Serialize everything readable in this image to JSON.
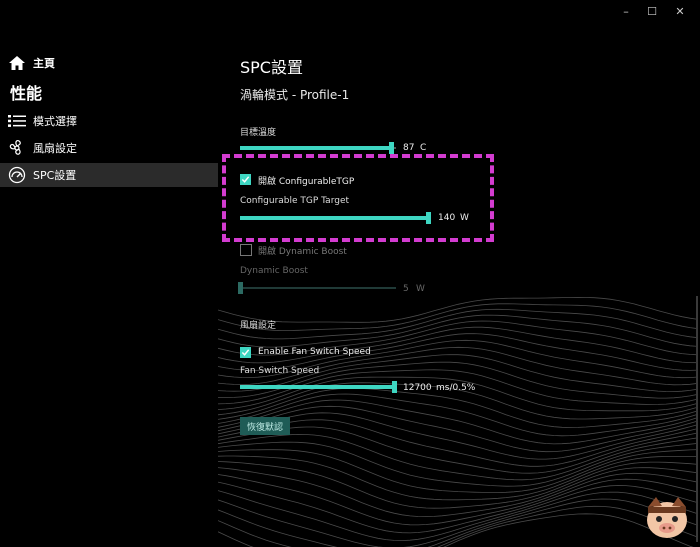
{
  "window": {
    "minimize": "–",
    "maximize": "☐",
    "close": "✕"
  },
  "sidebar": {
    "home_label": "主頁",
    "section_title": "性能",
    "items": [
      {
        "label": "模式選擇",
        "icon": "list-icon"
      },
      {
        "label": "風扇設定",
        "icon": "fan-icon"
      },
      {
        "label": "SPC設置",
        "icon": "speedometer-icon",
        "active": true
      }
    ]
  },
  "main": {
    "title": "SPC設置",
    "subtitle": "渦輪模式 - Profile-1",
    "target_temp": {
      "label": "目標溫度",
      "value": "87",
      "unit": "C",
      "level": 0.97
    },
    "configurable_tgp": {
      "checkbox_label": "開啟 ConfigurableTGP",
      "checked": true
    },
    "tgp_target": {
      "label": "Configurable TGP Target",
      "value": "140",
      "unit": "W",
      "level": 1.0
    },
    "dynamic_boost_toggle": {
      "checkbox_label": "開啟 Dynamic Boost",
      "checked": false
    },
    "dynamic_boost": {
      "label": "Dynamic Boost",
      "value": "5",
      "unit": "W",
      "level": 0.0
    },
    "fan_section_title": "風扇設定",
    "fan_switch": {
      "checkbox_label": "Enable Fan Switch Speed",
      "checked": true
    },
    "fan_switch_speed": {
      "label": "Fan Switch Speed",
      "value": "12700",
      "unit": "ms/0.5%",
      "level": 1.0
    },
    "reset_button": "恢復默認"
  },
  "colors": {
    "accent": "#3ed6c2",
    "highlight": "#d33cd0",
    "background": "#000000"
  }
}
